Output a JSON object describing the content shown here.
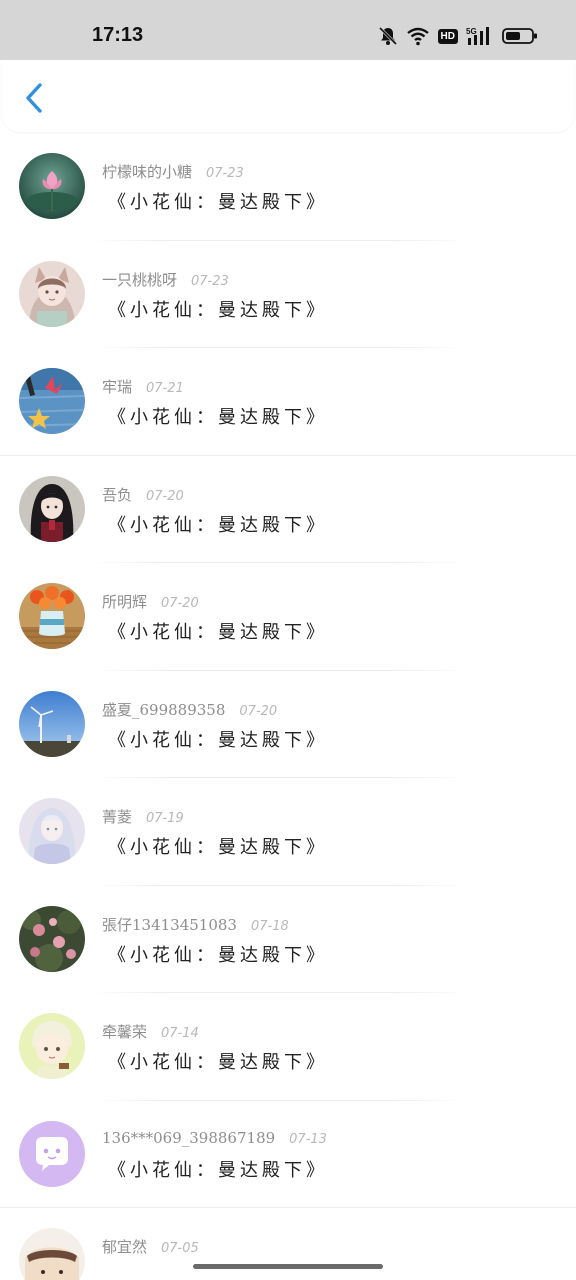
{
  "status_bar": {
    "time": "17:13",
    "hd_label": "HD",
    "network_label": "5G"
  },
  "nav": {
    "back_icon": "chevron-left-icon",
    "accent_color": "#2f8fe0"
  },
  "list": {
    "items": [
      {
        "name": "柠檬味的小糖",
        "date": "07-23",
        "title": "《小花仙：曼达殿下》",
        "avatar": "lotus"
      },
      {
        "name": "一只桃桃呀",
        "date": "07-23",
        "title": "《小花仙：曼达殿下》",
        "avatar": "anime-girl-fox"
      },
      {
        "name": "牢瑞",
        "date": "07-21",
        "title": "《小花仙：曼达殿下》",
        "avatar": "starfish-blue"
      },
      {
        "name": "吾负",
        "date": "07-20",
        "title": "《小花仙：曼达殿下》",
        "avatar": "dark-hair-girl"
      },
      {
        "name": "所明辉",
        "date": "07-20",
        "title": "《小花仙：曼达殿下》",
        "avatar": "flower-vase"
      },
      {
        "name": "盛夏_699889358",
        "date": "07-20",
        "title": "《小花仙：曼达殿下》",
        "avatar": "wind-turbine-sky"
      },
      {
        "name": "菁菱",
        "date": "07-19",
        "title": "《小花仙：曼达殿下》",
        "avatar": "white-hair-girl"
      },
      {
        "name": "張仔13413451083",
        "date": "07-18",
        "title": "《小花仙：曼达殿下》",
        "avatar": "roses"
      },
      {
        "name": "牵馨荣",
        "date": "07-14",
        "title": "《小花仙：曼达殿下》",
        "avatar": "cartoon-boy"
      },
      {
        "name": "136***069_398867189",
        "date": "07-13",
        "title": "《小花仙：曼达殿下》",
        "avatar": "chat-bubble-default"
      },
      {
        "name": "郁宜然",
        "date": "07-05",
        "title": "",
        "avatar": "partial"
      }
    ]
  }
}
